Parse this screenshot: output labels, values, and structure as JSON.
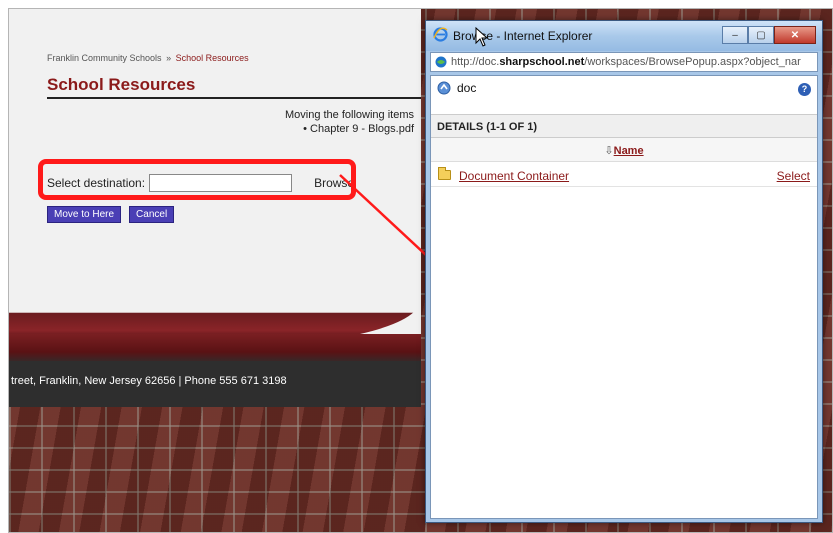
{
  "page": {
    "breadcrumb_root": "Franklin Community Schools",
    "breadcrumb_sep": "»",
    "breadcrumb_current": "School Resources",
    "title": "School Resources",
    "moving_label": "Moving the following items",
    "moving_items": [
      "Chapter 9 - Blogs.pdf"
    ],
    "select_destination_label": "Select destination:",
    "destination_value": "",
    "browse_label": "Browse",
    "move_button": "Move to Here",
    "cancel_button": "Cancel",
    "footer_text": "treet, Franklin, New Jersey 62656 | Phone 555 671 3198"
  },
  "popup": {
    "title": "Browse - Internet Explorer",
    "url_prefix": "http://doc.",
    "url_host": "sharpschool.net",
    "url_path": "/workspaces/BrowsePopup.aspx?object_nar",
    "folder_label": "doc",
    "help_label": "?",
    "details_header": "DETAILS (1-1 OF 1)",
    "sort_icon": "⇩",
    "column_name": "Name",
    "results": [
      {
        "name": "Document Container",
        "action": "Select"
      }
    ],
    "minimize": "–",
    "maximize": "▢",
    "close": "✕"
  },
  "colors": {
    "brand_red": "#8b1a1a",
    "highlight_red": "#ff1a1a",
    "button_purple": "#4a3fb5"
  }
}
